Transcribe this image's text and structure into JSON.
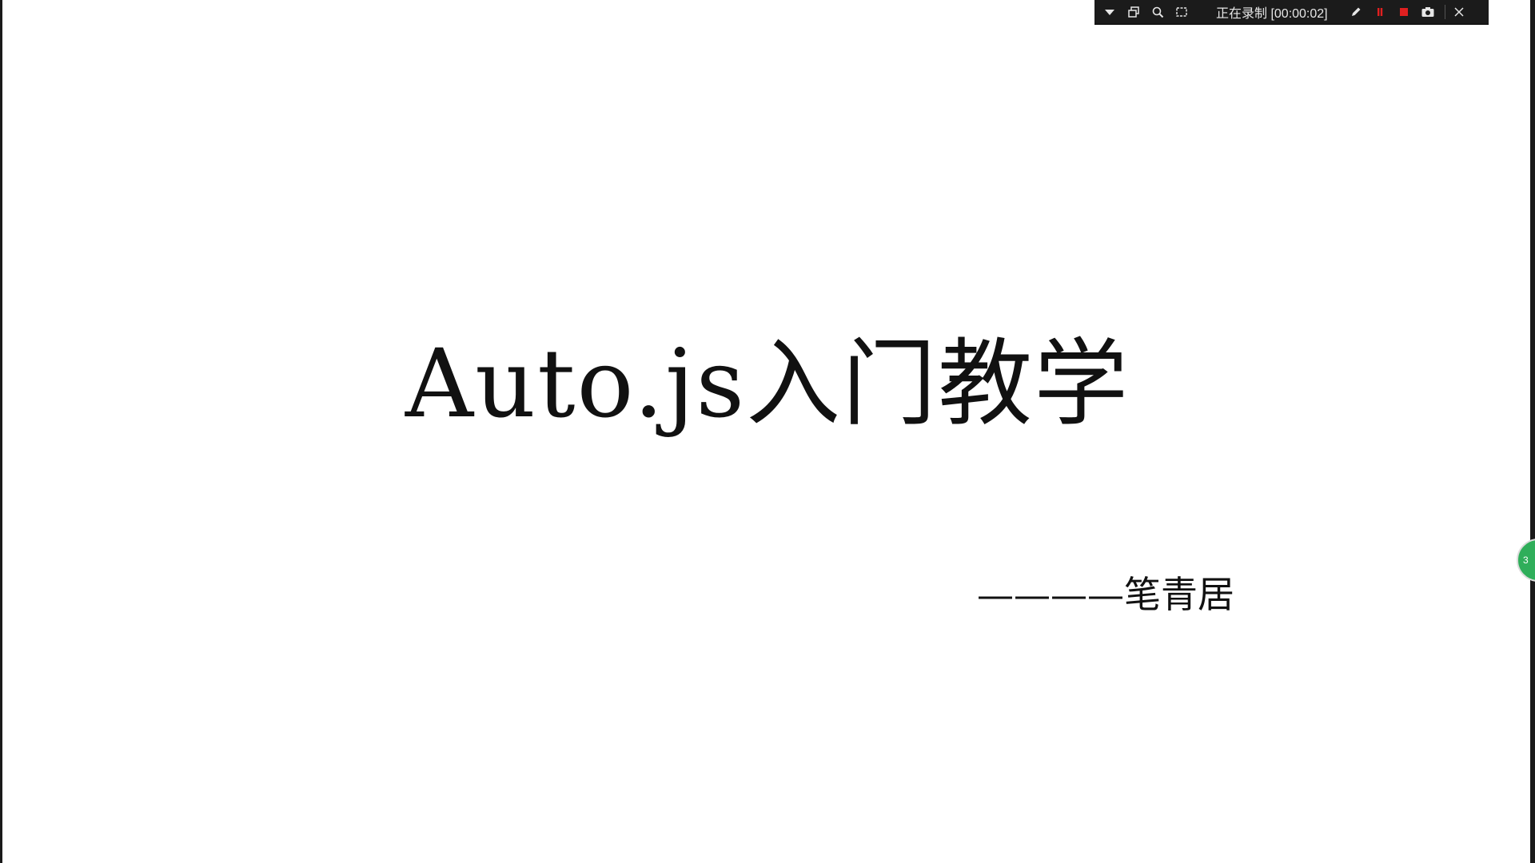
{
  "slide": {
    "title": "Auto.js入门教学",
    "author": "————笔青居"
  },
  "recorder": {
    "status_text": "正在录制 [00:00:02]",
    "icons": [
      "chevron-down-icon",
      "window-icon",
      "magnifier-icon",
      "region-icon",
      "pen-icon",
      "pause-icon",
      "stop-icon",
      "camera-icon",
      "close-icon"
    ],
    "colors": {
      "background": "#1b1b1b",
      "pause": "#e02020",
      "stop": "#e02020",
      "icon": "#e6e6e6"
    }
  },
  "side_badge": {
    "label": "3",
    "color": "#2fae5a"
  }
}
